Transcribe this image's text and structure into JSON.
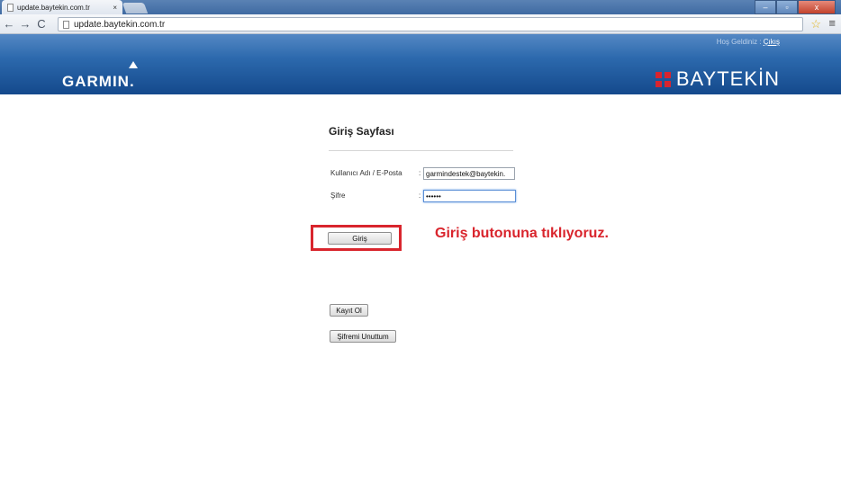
{
  "browser": {
    "tab_title": "update.baytekin.com.tr",
    "tab_close": "×",
    "url": "update.baytekin.com.tr",
    "win_min": "–",
    "win_max": "▫",
    "win_close": "x"
  },
  "header": {
    "welcome": "Hoş Geldiniz : ",
    "logout": "Çıkış",
    "garmin_logo": "GARMIN.",
    "baytekin_logo": "BAYTEKİN",
    "brand_color": "#d8242f",
    "header_color": "#2c69ad"
  },
  "form": {
    "title": "Giriş Sayfası",
    "username_label": "Kullanıcı Adı / E-Posta",
    "username_value": "garmindestek@baytekin.",
    "password_label": "Şifre",
    "password_value": "••••••",
    "colon": ":",
    "login_button": "Giriş",
    "register_button": "Kayıt Ol",
    "forgot_button": "Şifremi Unuttum"
  },
  "annotation": {
    "text": "Giriş butonuna tıklıyoruz.",
    "color": "#d9252d"
  },
  "icons": [
    "page-icon",
    "back-icon",
    "forward-icon",
    "reload-icon",
    "star-icon",
    "menu-icon",
    "baytekin-logo-icon",
    "garmin-triangle-icon"
  ]
}
